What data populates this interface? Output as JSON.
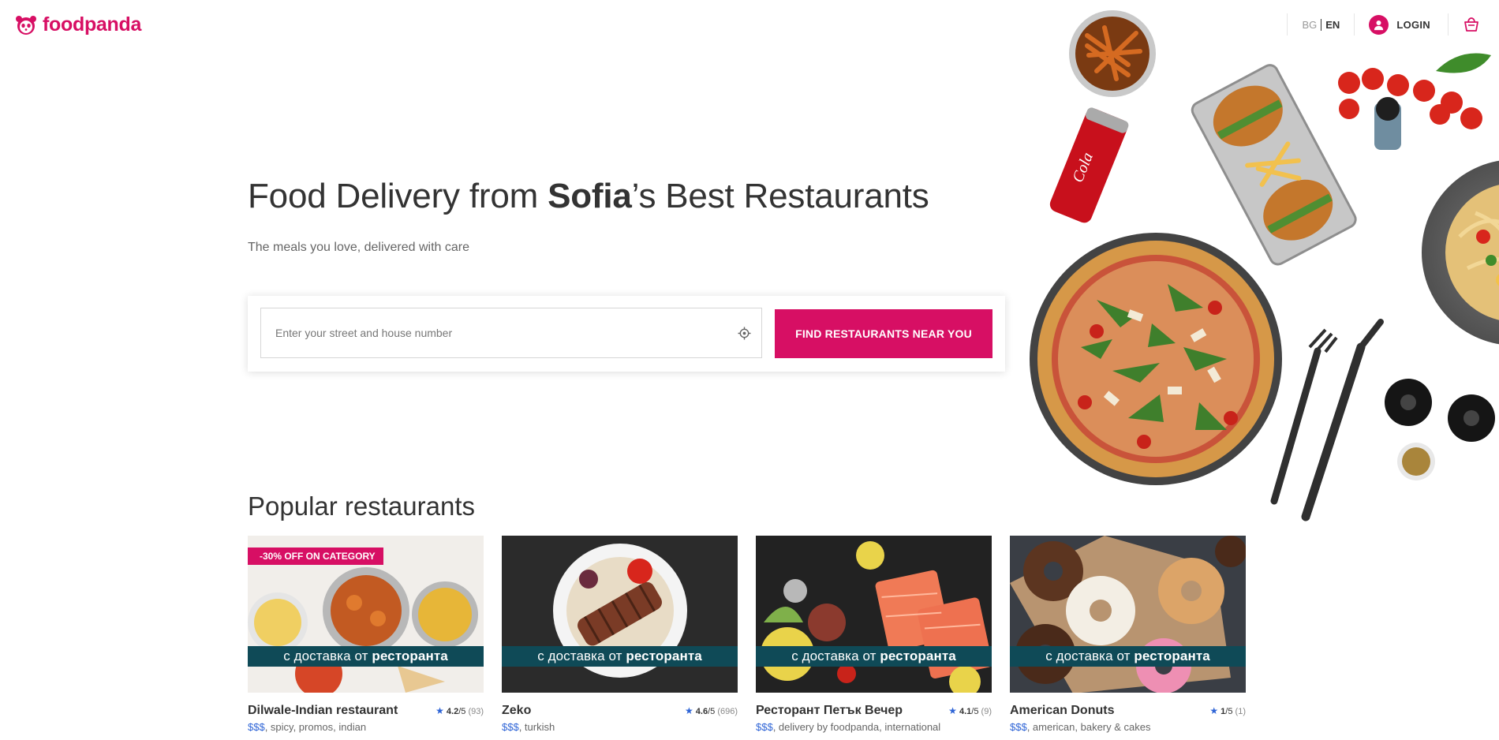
{
  "header": {
    "brand": "foodpanda",
    "lang_bg": "BG",
    "lang_en": "EN",
    "login_label": "LOGIN"
  },
  "hero": {
    "title_pre": "Food Delivery from ",
    "title_city": "Sofia",
    "title_post": "’s Best Restaurants",
    "subtitle": "The meals you love, delivered with care",
    "search_placeholder": "Enter your street and house number",
    "search_value": "",
    "find_button": "FIND RESTAURANTS NEAR YOU"
  },
  "popular": {
    "title": "Popular restaurants",
    "banner_pre": "с доставка от ",
    "banner_bold": "ресторанта",
    "restaurants": [
      {
        "name": "Dilwale-Indian restaurant",
        "promo": "-30% OFF ON CATEGORY",
        "score": "4.2",
        "out_of": "/5",
        "count": "(93)",
        "price": "$$$",
        "tags": ", spicy, promos, indian"
      },
      {
        "name": "Zeko",
        "promo": "",
        "score": "4.6",
        "out_of": "/5",
        "count": "(696)",
        "price": "$$$",
        "tags": ", turkish"
      },
      {
        "name": "Ресторант Петък Вечер",
        "promo": "",
        "score": "4.1",
        "out_of": "/5",
        "count": "(9)",
        "price": "$$$",
        "tags": ", delivery by foodpanda, international"
      },
      {
        "name": "American Donuts",
        "promo": "",
        "score": "1",
        "out_of": "/5",
        "count": "(1)",
        "price": "$$$",
        "tags": ", american, bakery & cakes"
      }
    ]
  },
  "colors": {
    "brand": "#d70f64",
    "banner": "#0f4a57",
    "rating_star": "#2e64d6"
  },
  "icons": [
    "panda-logo-icon",
    "user-icon",
    "cart-icon",
    "locate-icon",
    "star-icon"
  ]
}
